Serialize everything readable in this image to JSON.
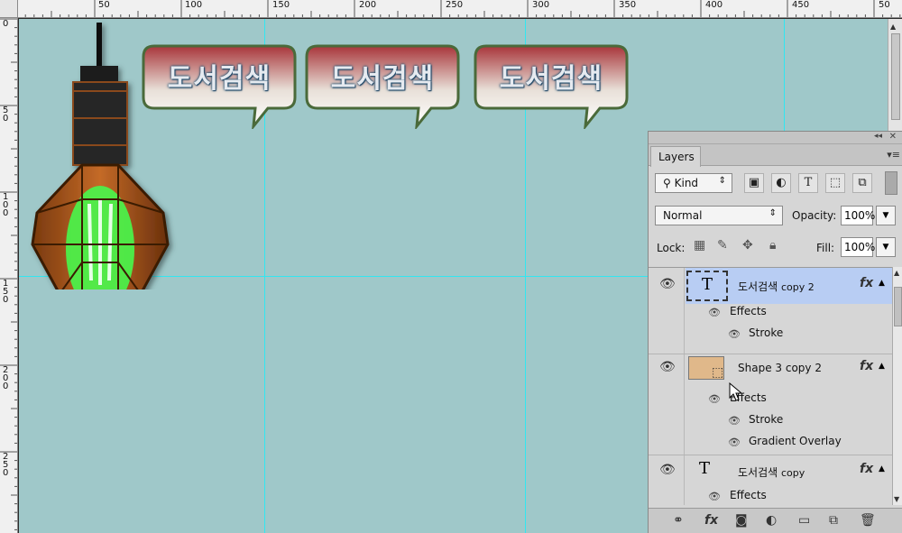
{
  "ruler": {
    "top_labels": [
      "50",
      "100",
      "150",
      "200",
      "250",
      "300",
      "350",
      "400",
      "450",
      "50"
    ],
    "left_labels": [
      "0",
      "50",
      "100",
      "150",
      "200",
      "250"
    ]
  },
  "canvas": {
    "background": "#9fc8c9",
    "bubble_texts": [
      "도서검색",
      "도서검색",
      "도서검색"
    ]
  },
  "panel": {
    "tab": "Layers",
    "filter_kind": "Kind",
    "blend_mode": "Normal",
    "opacity_label": "Opacity:",
    "opacity_value": "100%",
    "lock_label": "Lock:",
    "fill_label": "Fill:",
    "fill_value": "100%",
    "layers": [
      {
        "name": "도서검색",
        "suffix": "copy 2",
        "selected": true,
        "effects_label": "Effects",
        "effects": [
          "Stroke"
        ]
      },
      {
        "name": "Shape 3 copy 2",
        "suffix": "",
        "selected": false,
        "effects_label": "Effects",
        "effects": [
          "Stroke",
          "Gradient Overlay"
        ]
      },
      {
        "name": "도서검색",
        "suffix": "copy",
        "selected": false,
        "effects_label": "Effects",
        "effects": []
      }
    ],
    "fx_label": "fx",
    "type_thumb": "T"
  },
  "colors": {
    "accent_selected": "#b8cdf3",
    "guide": "#32e6f0"
  }
}
